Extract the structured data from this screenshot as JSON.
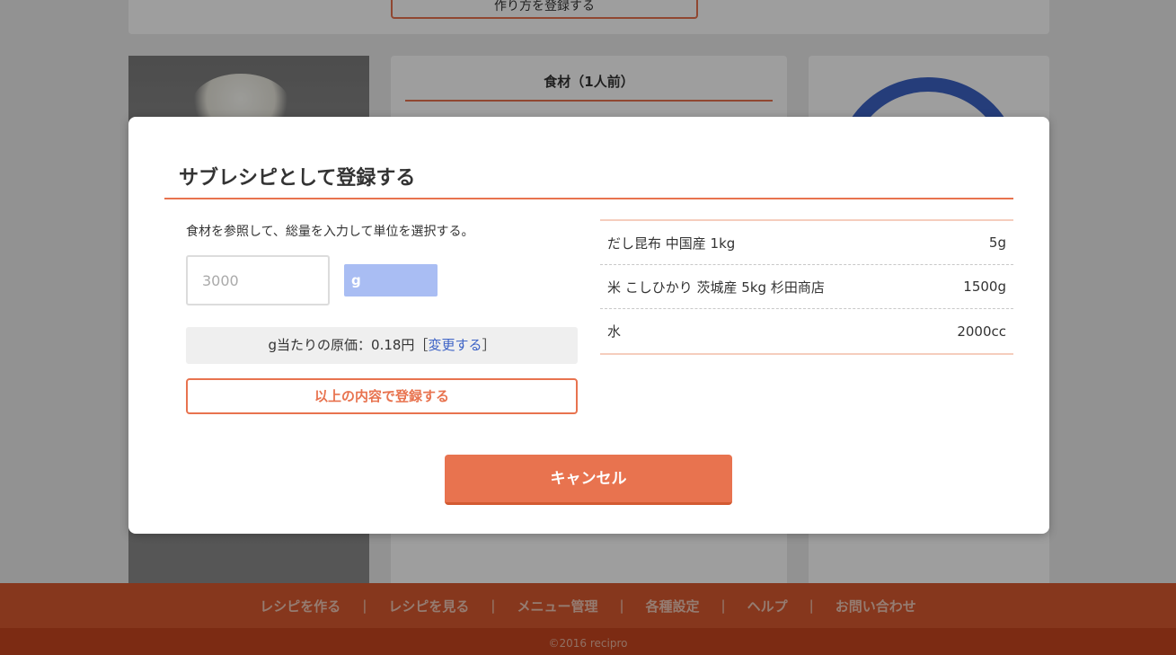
{
  "background": {
    "howto_button_label": "作り方を登録する",
    "ingredients_title": "食材（1人前）"
  },
  "modal": {
    "title": "サブレシピとして登録する",
    "instruction": "食材を参照して、総量を入力して単位を選択する。",
    "total_input": {
      "value": "",
      "placeholder": "3000"
    },
    "unit_select": {
      "value": "g"
    },
    "cost_text": "g当たりの原価：0.18円［",
    "cost_link": "変更する",
    "cost_close": "］",
    "register_label": "以上の内容で登録する",
    "cancel_label": "キャンセル",
    "ingredients": [
      {
        "name": "だし昆布 中国産 1kg",
        "amount": "5g"
      },
      {
        "name": "米 こしひかり 茨城産 5kg 杉田商店",
        "amount": "1500g"
      },
      {
        "name": "水",
        "amount": "2000cc"
      }
    ]
  },
  "footer": {
    "nav": [
      "レシピを作る",
      "レシピを見る",
      "メニュー管理",
      "各種設定",
      "ヘルプ",
      "お問い合わせ"
    ],
    "separator": "|",
    "copyright": "©2016 recipro"
  },
  "colors": {
    "accent": "#e8734f",
    "link": "#3d63c6",
    "unit_select_bg": "#a9bdf3",
    "footer_bg": "#d9592f"
  }
}
